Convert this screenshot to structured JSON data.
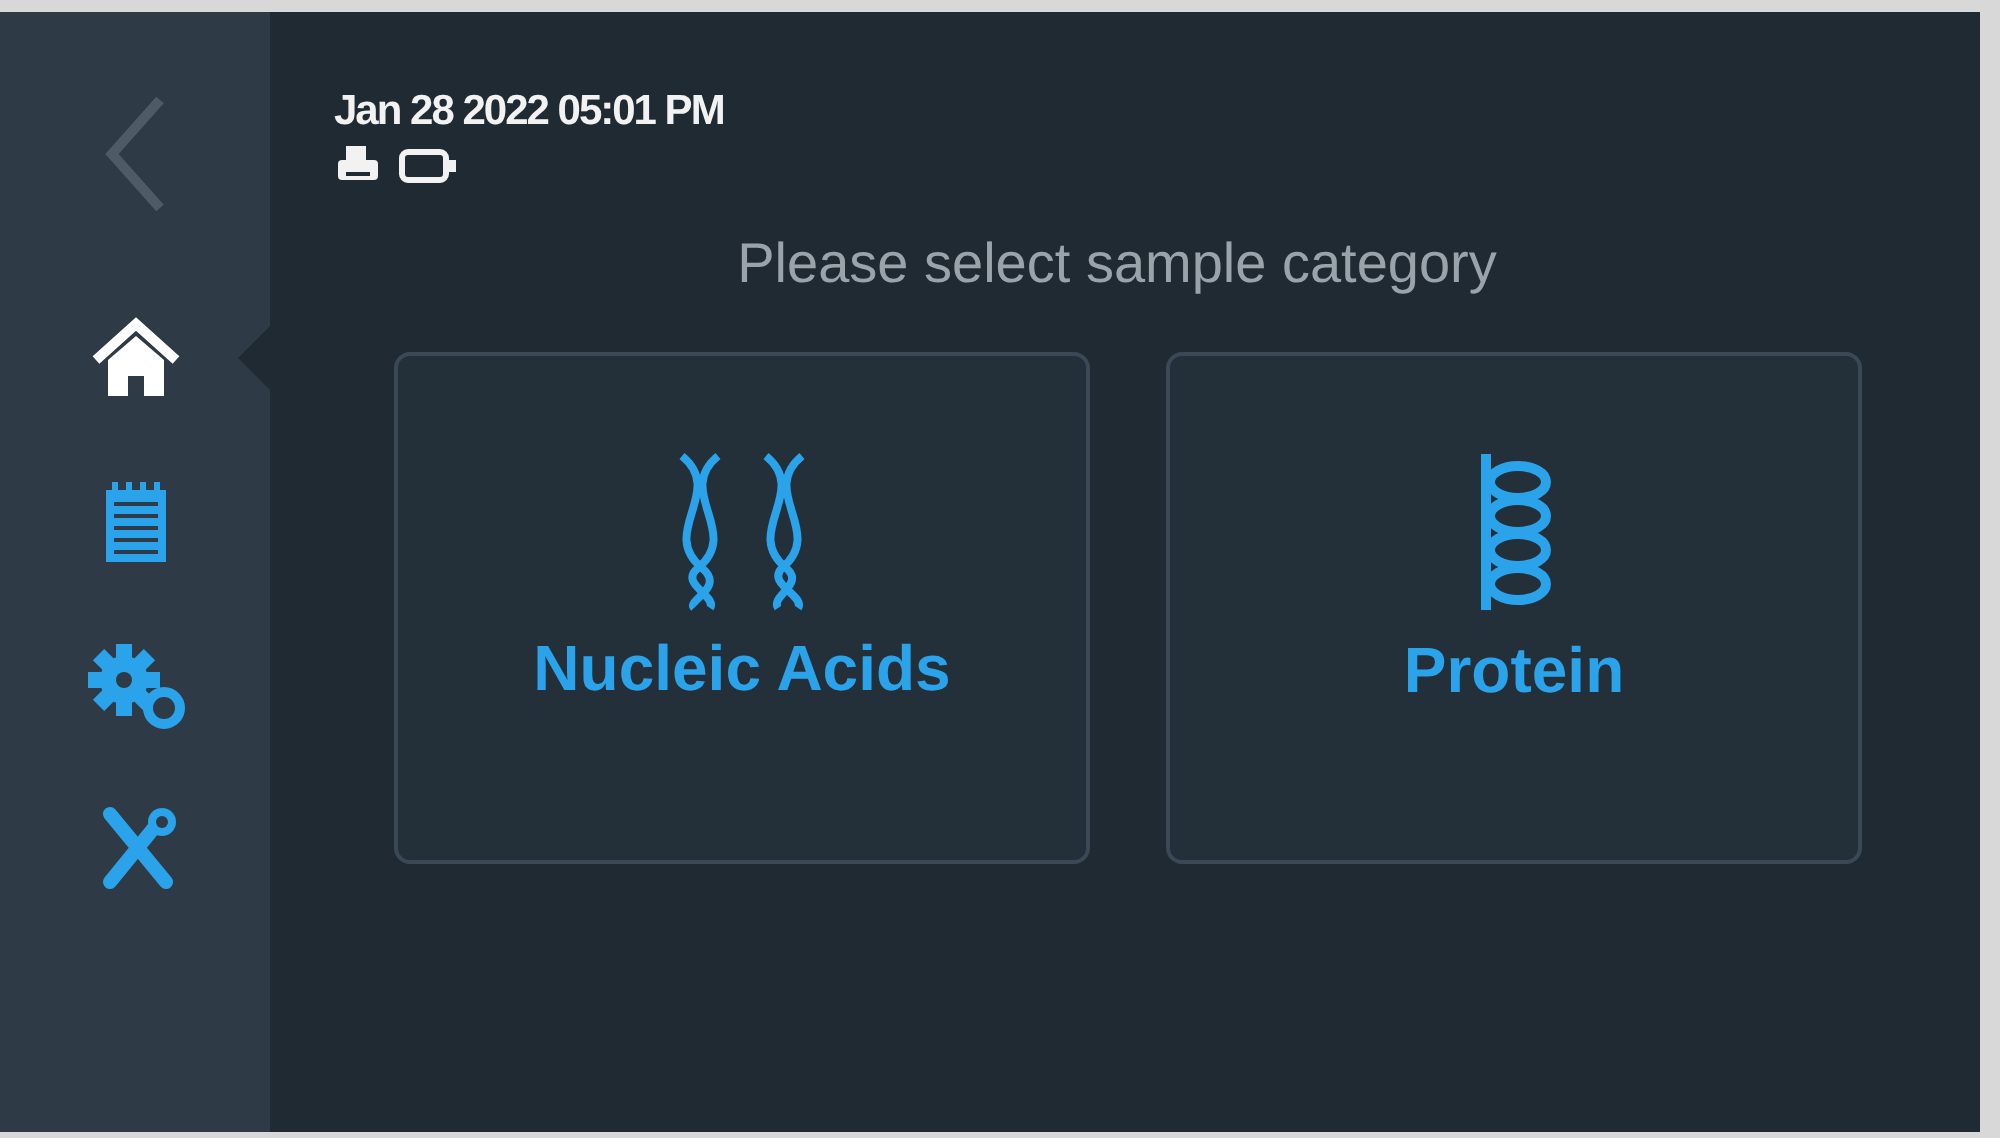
{
  "sidebar": {
    "back": {
      "disabled": true
    },
    "items": [
      {
        "kind": "home",
        "selected": true
      },
      {
        "kind": "notebook",
        "selected": false
      },
      {
        "kind": "gears",
        "selected": false
      },
      {
        "kind": "tools",
        "selected": false
      }
    ]
  },
  "header": {
    "datetime": "Jan 28 2022 05:01 PM"
  },
  "prompt": "Please select sample category",
  "categories": [
    {
      "kind": "dna",
      "label": "Nucleic Acids"
    },
    {
      "kind": "helix",
      "label": "Protein"
    }
  ]
}
